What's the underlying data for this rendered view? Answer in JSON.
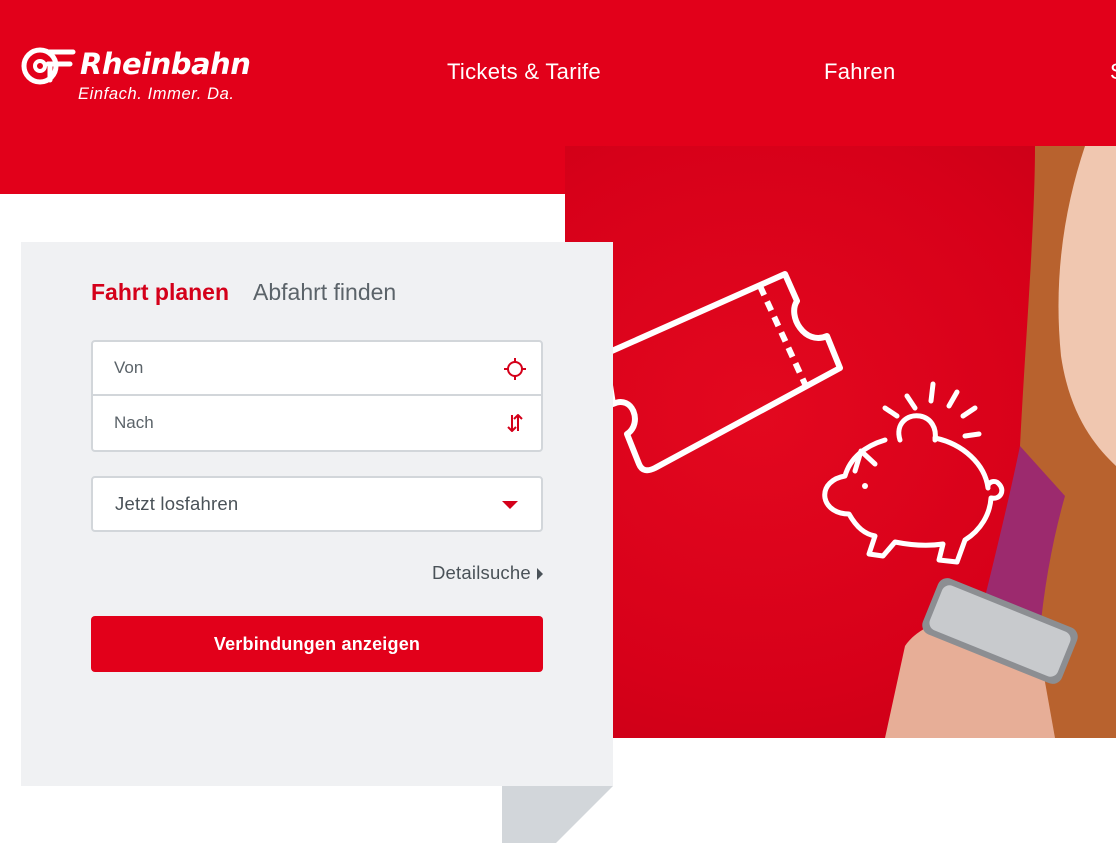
{
  "brand": {
    "name": "Rheinbahn",
    "slogan": "Einfach. Immer. Da.",
    "color": "#e2001a"
  },
  "nav": {
    "items": [
      {
        "label": "Tickets & Tarife"
      },
      {
        "label": "Fahren"
      },
      {
        "label": "S"
      }
    ]
  },
  "planner": {
    "tabs": [
      {
        "label": "Fahrt planen",
        "active": true
      },
      {
        "label": "Abfahrt finden",
        "active": false
      }
    ],
    "from": {
      "placeholder": "Von",
      "value": "",
      "icon": "locate-icon"
    },
    "to": {
      "placeholder": "Nach",
      "value": "",
      "icon": "swap-icon"
    },
    "time_select": {
      "value": "Jetzt losfahren"
    },
    "detail_link": "Detailsuche",
    "submit_label": "Verbindungen anzeigen"
  },
  "colors": {
    "accent": "#e2001a",
    "panel": "#f0f1f3",
    "text_muted": "#5b6369"
  }
}
